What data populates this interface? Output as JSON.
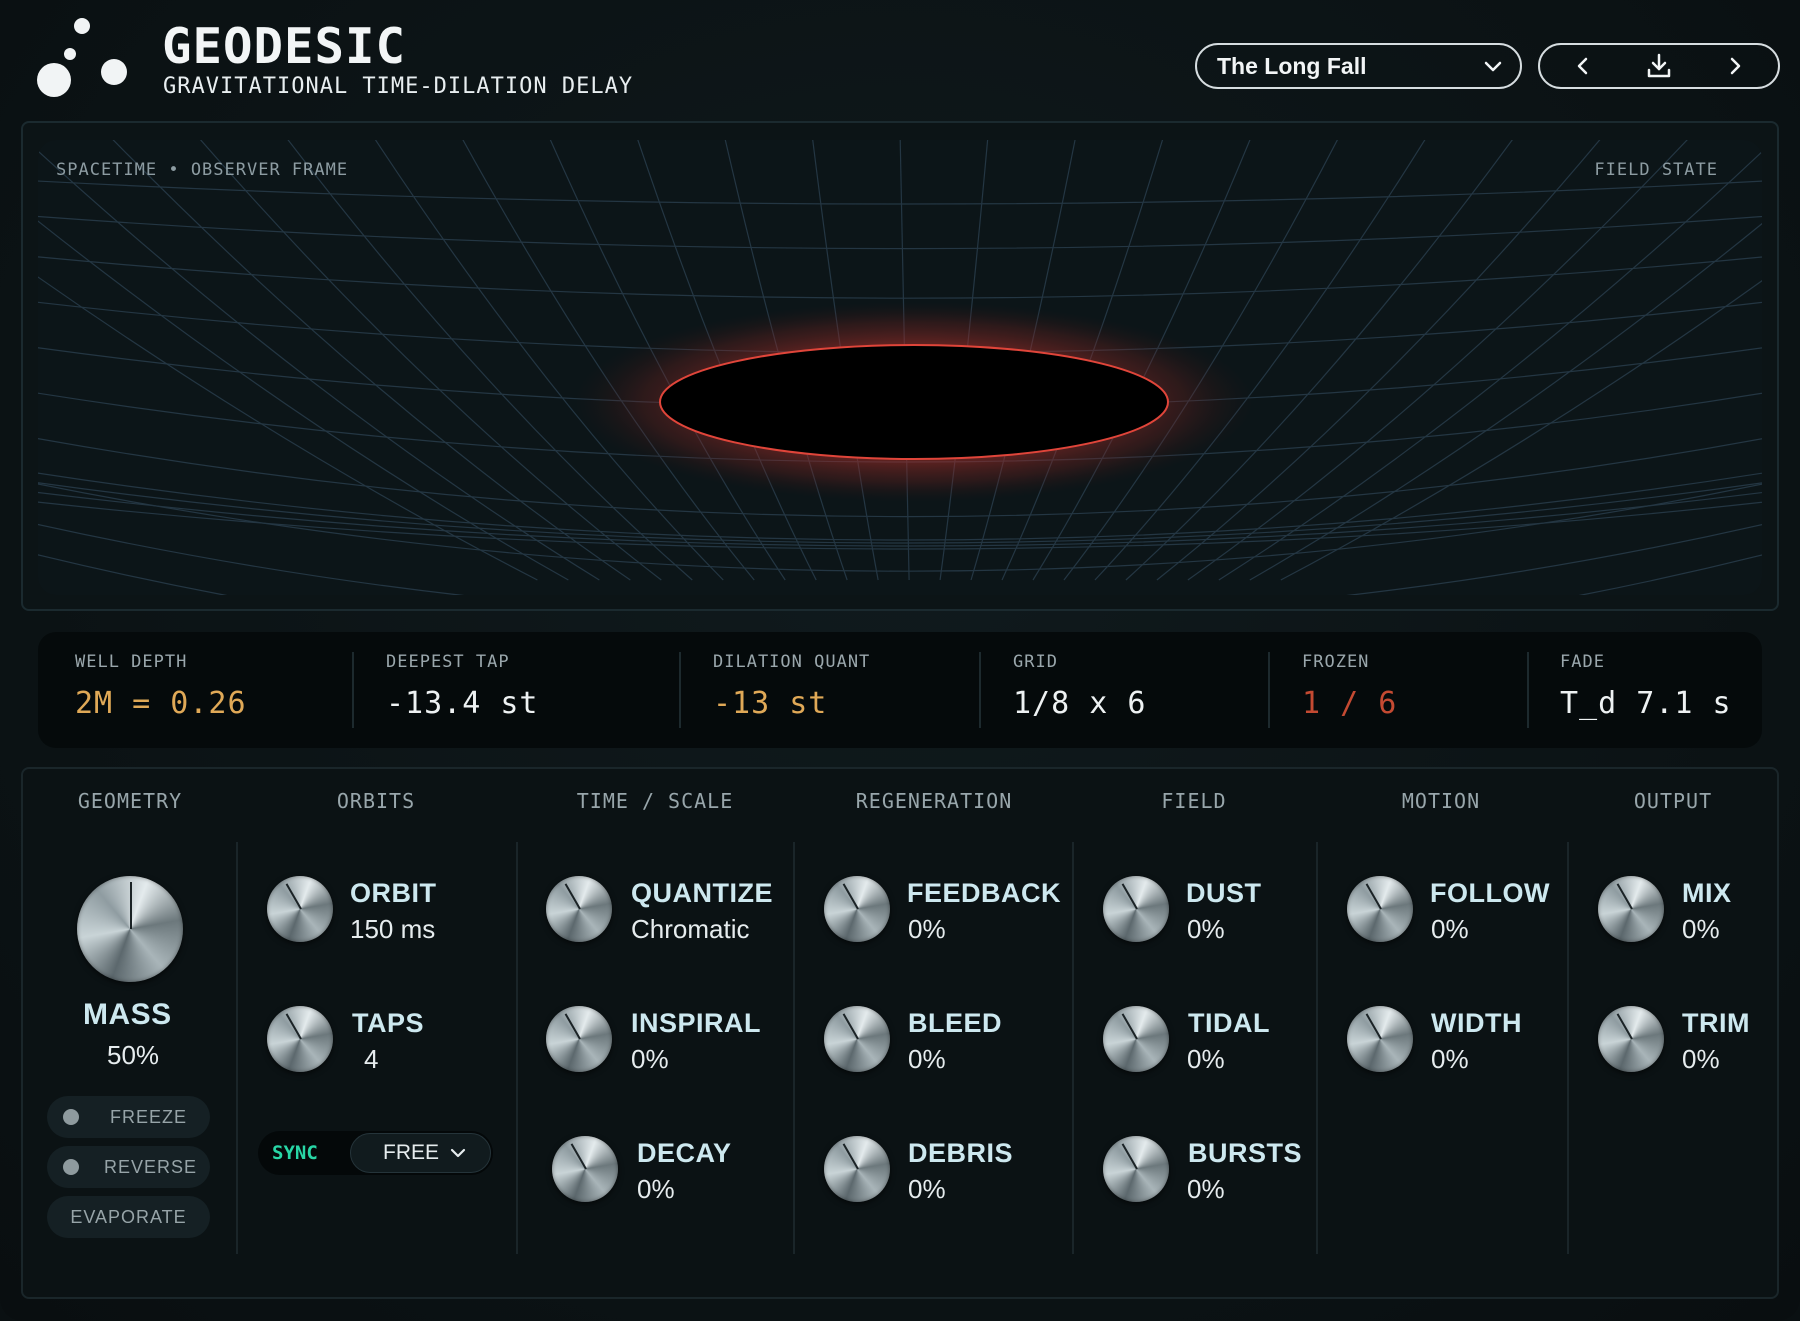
{
  "header": {
    "title": "GEODESIC",
    "subtitle": "GRAVITATIONAL TIME-DILATION DELAY",
    "preset": "The Long Fall"
  },
  "icons": {
    "logo": "three-dots-logo",
    "preset_dropdown": "chevron-down-icon",
    "prev": "chevron-left-icon",
    "save": "download-icon",
    "next": "chevron-right-icon"
  },
  "visualizer": {
    "left_label": "SPACETIME • OBSERVER FRAME",
    "right_label": "FIELD STATE"
  },
  "status": [
    {
      "label": "WELL DEPTH",
      "value": "2M = 0.26",
      "color": "#e0a957"
    },
    {
      "label": "DEEPEST TAP",
      "value": "-13.4 st",
      "color": "#eef2f3"
    },
    {
      "label": "DILATION QUANT",
      "value": "-13 st",
      "color": "#e0a957"
    },
    {
      "label": "GRID",
      "value": "1/8 x 6",
      "color": "#eef2f3"
    },
    {
      "label": "FROZEN",
      "value": "1 / 6",
      "color": "#c44a32"
    },
    {
      "label": "FADE",
      "value": "T_d 7.1 s",
      "color": "#eef2f3"
    }
  ],
  "sections": [
    "GEOMETRY",
    "ORBITS",
    "TIME / SCALE",
    "REGENERATION",
    "FIELD",
    "MOTION",
    "OUTPUT"
  ],
  "geometry": {
    "mass": {
      "name": "MASS",
      "value": "50%"
    },
    "buttons": {
      "freeze": "FREEZE",
      "reverse": "REVERSE",
      "evaporate": "EVAPORATE"
    }
  },
  "orbits": {
    "orbit": {
      "name": "ORBIT",
      "value": "150 ms"
    },
    "taps": {
      "name": "TAPS",
      "value": "4"
    },
    "sync_label": "SYNC",
    "sync_mode": "FREE"
  },
  "time_scale": {
    "quantize": {
      "name": "QUANTIZE",
      "value": "Chromatic"
    },
    "inspiral": {
      "name": "INSPIRAL",
      "value": "0%"
    },
    "decay": {
      "name": "DECAY",
      "value": "0%"
    }
  },
  "regeneration": {
    "feedback": {
      "name": "FEEDBACK",
      "value": "0%"
    },
    "bleed": {
      "name": "BLEED",
      "value": "0%"
    },
    "debris": {
      "name": "DEBRIS",
      "value": "0%"
    }
  },
  "field": {
    "dust": {
      "name": "DUST",
      "value": "0%"
    },
    "tidal": {
      "name": "TIDAL",
      "value": "0%"
    },
    "bursts": {
      "name": "BURSTS",
      "value": "0%"
    }
  },
  "motion": {
    "follow": {
      "name": "FOLLOW",
      "value": "0%"
    },
    "width": {
      "name": "WIDTH",
      "value": "0%"
    }
  },
  "output": {
    "mix": {
      "name": "MIX",
      "value": "0%"
    },
    "trim": {
      "name": "TRIM",
      "value": "0%"
    }
  },
  "colors": {
    "accent_teal": "#28d6a6",
    "accent_amber": "#e0a957",
    "accent_red": "#c44a32",
    "knob_label": "#cde8ef"
  }
}
